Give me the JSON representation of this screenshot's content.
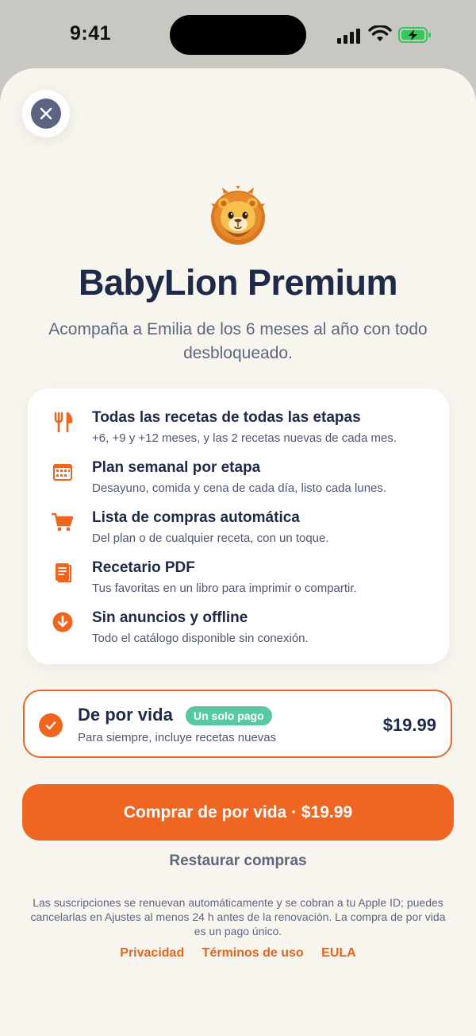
{
  "status_bar": {
    "time": "9:41"
  },
  "header": {
    "title": "BabyLion Premium",
    "subtitle": "Acompaña a Emilia de los 6 meses al año con todo desbloqueado."
  },
  "features": [
    {
      "icon": "fork-knife-icon",
      "title": "Todas las recetas de todas las etapas",
      "description": "+6, +9 y +12 meses, y las 2 recetas nuevas de cada mes."
    },
    {
      "icon": "calendar-icon",
      "title": "Plan semanal por etapa",
      "description": "Desayuno, comida y cena de cada día, listo cada lunes."
    },
    {
      "icon": "cart-icon",
      "title": "Lista de compras automática",
      "description": "Del plan o de cualquier receta, con un toque."
    },
    {
      "icon": "book-icon",
      "title": "Recetario PDF",
      "description": "Tus favoritas en un libro para imprimir o compartir."
    },
    {
      "icon": "download-icon",
      "title": "Sin anuncios y offline",
      "description": "Todo el catálogo disponible sin conexión."
    }
  ],
  "plan": {
    "name": "De por vida",
    "badge": "Un solo pago",
    "description": "Para siempre, incluye recetas nuevas",
    "price": "$19.99",
    "selected": true
  },
  "buy_button": {
    "label": "Comprar de por vida · $19.99"
  },
  "restore_label": "Restaurar compras",
  "legal_text": "Las suscripciones se renuevan automáticamente y se cobran a tu Apple ID; puedes cancelarlas en Ajustes al menos 24 h antes de la renovación. La compra de por vida es un pago único.",
  "links": {
    "privacy": "Privacidad",
    "terms": "Términos de uso",
    "eula": "EULA"
  },
  "colors": {
    "accent": "#ef6522",
    "badge": "#58c7a4",
    "title": "#1e2a48",
    "background": "#f8f4ee",
    "battery": "#34c759"
  }
}
